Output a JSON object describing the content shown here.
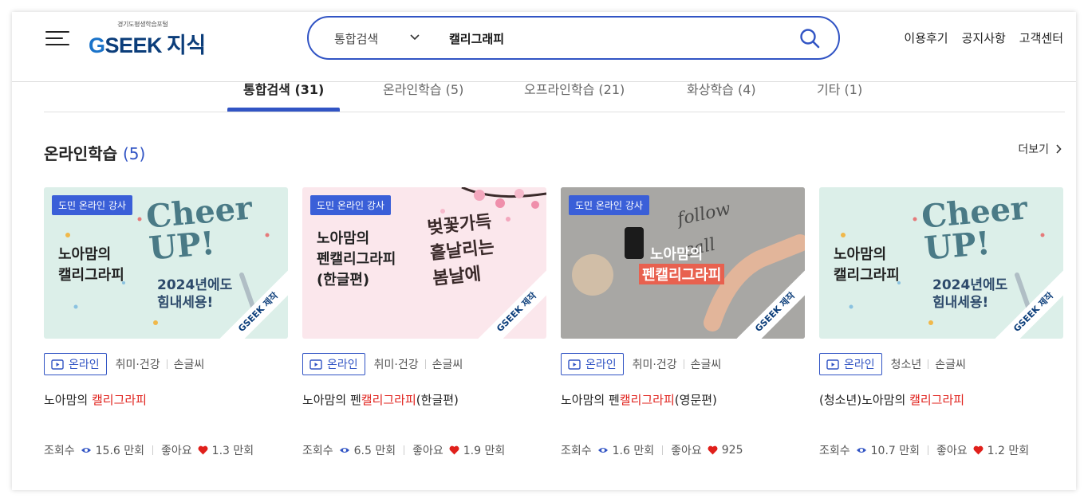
{
  "header": {
    "logo_sub": "경기도평생학습포털",
    "logo_g": "G",
    "logo_seek": "SEEK",
    "logo_kr": "지식",
    "search_scope": "통합검색",
    "search_value": "캘리그래피",
    "nav": [
      "이용후기",
      "공지사항",
      "고객센터"
    ]
  },
  "tabs": [
    {
      "label": "통합검색 (31)",
      "active": true
    },
    {
      "label": "온라인학습 (5)",
      "active": false
    },
    {
      "label": "오프라인학습 (21)",
      "active": false
    },
    {
      "label": "화상학습 (4)",
      "active": false
    },
    {
      "label": "기타 (1)",
      "active": false
    }
  ],
  "section": {
    "title": "온라인학습",
    "count": "(5)",
    "more_label": "더보기"
  },
  "cards": [
    {
      "badge": "도민 온라인 강사",
      "thumb_title": "노아맘의\n캘리그라피",
      "thumb_art": "Cheer\nUP!",
      "thumb_art_sub": "2024년에도\n힘내세용!",
      "ribbon": "GSEEK 제작",
      "tag": "온라인",
      "category": "취미·건강",
      "provider": "손글씨",
      "title_prefix": "노아맘의 ",
      "title_highlight": "캘리그라피",
      "title_suffix": "",
      "views_label": "조회수",
      "views": "15.6 만회",
      "likes_label": "좋아요",
      "likes": "1.3 만회"
    },
    {
      "badge": "도민 온라인 강사",
      "thumb_title": "노아맘의\n펜캘리그라피\n(한글편)",
      "thumb_art": "벚꽃가득\n흩날리는\n봄날에",
      "ribbon": "GSEEK 제작",
      "tag": "온라인",
      "category": "취미·건강",
      "provider": "손글씨",
      "title_prefix": "노아맘의 펜",
      "title_highlight": "캘리그라피",
      "title_suffix": "(한글편)",
      "views_label": "조회수",
      "views": "6.5 만회",
      "likes_label": "좋아요",
      "likes": "1.9 만회"
    },
    {
      "badge": "도민 온라인 강사",
      "thumb_title": "노아맘의",
      "thumb_title2": "펜캘리그라피",
      "thumb_art": "follow\ncall",
      "ribbon": "GSEEK 제작",
      "tag": "온라인",
      "category": "취미·건강",
      "provider": "손글씨",
      "title_prefix": "노아맘의 펜",
      "title_highlight": "캘리그라피",
      "title_suffix": "(영문편)",
      "views_label": "조회수",
      "views": "1.6 만회",
      "likes_label": "좋아요",
      "likes": "925"
    },
    {
      "thumb_title": "노아맘의\n캘리그라피",
      "thumb_art": "Cheer\nUP!",
      "thumb_art_sub": "2024년에도\n힘내세용!",
      "ribbon": "GSEEK 제작",
      "tag": "온라인",
      "category": "청소년",
      "provider": "손글씨",
      "title_prefix": "(청소년)노아맘의 ",
      "title_highlight": "캘리그라피",
      "title_suffix": "",
      "views_label": "조회수",
      "views": "10.7 만회",
      "likes_label": "좋아요",
      "likes": "1.2 만회"
    }
  ],
  "colors": {
    "accent": "#3154c4",
    "highlight": "#e0201b",
    "heart": "#e0201b",
    "card1_bg": "#dcefe9",
    "card2_bg": "#fbe7ec",
    "card3_bg": "#9a9a9a",
    "card4_bg": "#dcefe9"
  }
}
